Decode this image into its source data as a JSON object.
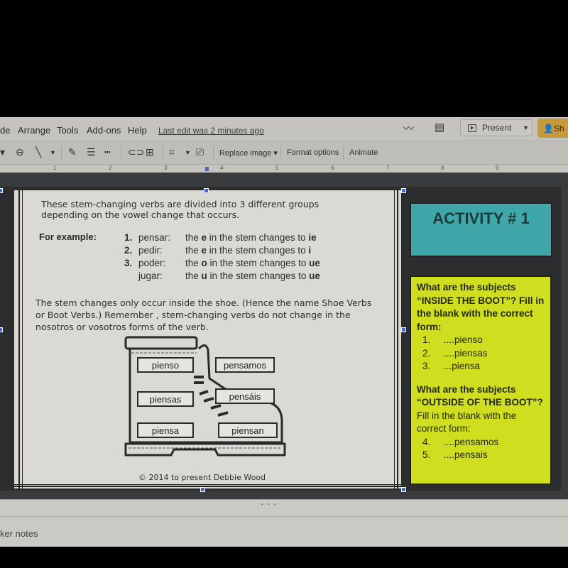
{
  "menubar": {
    "items": [
      "de",
      "Arrange",
      "Tools",
      "Add-ons",
      "Help"
    ],
    "last_edit": "Last edit was 2 minutes ago",
    "activity_icon": "trending-up-icon",
    "comments_icon": "comment-icon",
    "present_label": "Present",
    "share_label": "Sh"
  },
  "toolbar": {
    "replace_image": "Replace image ▾",
    "format_options": "Format options",
    "animate": "Animate"
  },
  "ruler": {
    "ticks": [
      "1",
      "2",
      "3",
      "4",
      "5",
      "6",
      "7",
      "8",
      "9"
    ]
  },
  "slide": {
    "intro": "These stem-changing verbs are divided into 3 different groups depending on the vowel change that occurs.",
    "for_example": "For example:",
    "examples": [
      {
        "num": "1.",
        "verb": "pensar:",
        "pre": "the ",
        "letter": "e",
        "mid": " in the stem changes to ",
        "change": "ie"
      },
      {
        "num": "2.",
        "verb": "pedir:",
        "pre": "the ",
        "letter": "e",
        "mid": " in the stem changes to ",
        "change": "i"
      },
      {
        "num": "3.",
        "verb": "poder:",
        "pre": "the ",
        "letter": "o",
        "mid": " in the stem changes to ",
        "change": "ue"
      },
      {
        "num": "",
        "verb": "jugar:",
        "pre": "the ",
        "letter": "u",
        "mid": " in the stem changes to ",
        "change": "ue"
      }
    ],
    "paragraph": "The stem changes only occur inside the shoe. (Hence the name Shoe Verbs or Boot Verbs.)   Remember , stem-changing verbs do not change in the nosotros or vosotros forms of the verb.",
    "boot_words": {
      "yo": "pienso",
      "tu": "piensas",
      "el": "piensa",
      "nosotros": "pensamos",
      "vosotros": "pensáis",
      "ellos": "piensan"
    },
    "copyright": "© 2014 to present Debbie Wood",
    "activity_title": "ACTIVITY # 1",
    "inside_question": "What are the subjects “INSIDE THE BOOT”? Fill in the blank with the correct form:",
    "inside_items": [
      {
        "n": "1.",
        "text": "....pienso"
      },
      {
        "n": "2.",
        "text": "....piensas"
      },
      {
        "n": "3.",
        "text": "...piensa"
      }
    ],
    "outside_question": "What are the subjects “OUTSIDE OF THE BOOT”?",
    "outside_instruction": "Fill in the blank with the correct form:",
    "outside_items": [
      {
        "n": "4.",
        "text": "....pensamos"
      },
      {
        "n": "5.",
        "text": "....pensais"
      }
    ]
  },
  "speaker_notes": {
    "label": "ker notes",
    "dots": "• • •"
  },
  "colors": {
    "activity_bg": "#3fa7aa",
    "question_bg": "#cfde1f",
    "share_btn": "#c49a3c",
    "selection": "#4a68c7"
  }
}
